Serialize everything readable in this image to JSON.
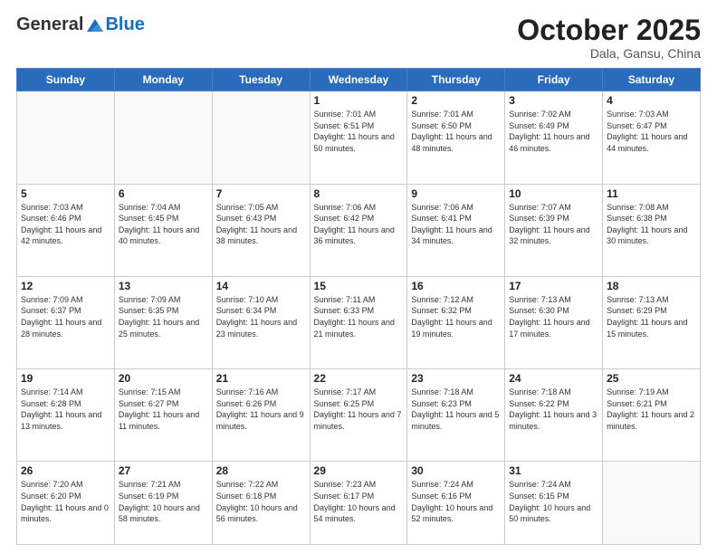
{
  "logo": {
    "general": "General",
    "blue": "Blue"
  },
  "title": "October 2025",
  "location": "Dala, Gansu, China",
  "days_of_week": [
    "Sunday",
    "Monday",
    "Tuesday",
    "Wednesday",
    "Thursday",
    "Friday",
    "Saturday"
  ],
  "weeks": [
    [
      {
        "day": "",
        "info": ""
      },
      {
        "day": "",
        "info": ""
      },
      {
        "day": "",
        "info": ""
      },
      {
        "day": "1",
        "info": "Sunrise: 7:01 AM\nSunset: 6:51 PM\nDaylight: 11 hours\nand 50 minutes."
      },
      {
        "day": "2",
        "info": "Sunrise: 7:01 AM\nSunset: 6:50 PM\nDaylight: 11 hours\nand 48 minutes."
      },
      {
        "day": "3",
        "info": "Sunrise: 7:02 AM\nSunset: 6:49 PM\nDaylight: 11 hours\nand 46 minutes."
      },
      {
        "day": "4",
        "info": "Sunrise: 7:03 AM\nSunset: 6:47 PM\nDaylight: 11 hours\nand 44 minutes."
      }
    ],
    [
      {
        "day": "5",
        "info": "Sunrise: 7:03 AM\nSunset: 6:46 PM\nDaylight: 11 hours\nand 42 minutes."
      },
      {
        "day": "6",
        "info": "Sunrise: 7:04 AM\nSunset: 6:45 PM\nDaylight: 11 hours\nand 40 minutes."
      },
      {
        "day": "7",
        "info": "Sunrise: 7:05 AM\nSunset: 6:43 PM\nDaylight: 11 hours\nand 38 minutes."
      },
      {
        "day": "8",
        "info": "Sunrise: 7:06 AM\nSunset: 6:42 PM\nDaylight: 11 hours\nand 36 minutes."
      },
      {
        "day": "9",
        "info": "Sunrise: 7:06 AM\nSunset: 6:41 PM\nDaylight: 11 hours\nand 34 minutes."
      },
      {
        "day": "10",
        "info": "Sunrise: 7:07 AM\nSunset: 6:39 PM\nDaylight: 11 hours\nand 32 minutes."
      },
      {
        "day": "11",
        "info": "Sunrise: 7:08 AM\nSunset: 6:38 PM\nDaylight: 11 hours\nand 30 minutes."
      }
    ],
    [
      {
        "day": "12",
        "info": "Sunrise: 7:09 AM\nSunset: 6:37 PM\nDaylight: 11 hours\nand 28 minutes."
      },
      {
        "day": "13",
        "info": "Sunrise: 7:09 AM\nSunset: 6:35 PM\nDaylight: 11 hours\nand 25 minutes."
      },
      {
        "day": "14",
        "info": "Sunrise: 7:10 AM\nSunset: 6:34 PM\nDaylight: 11 hours\nand 23 minutes."
      },
      {
        "day": "15",
        "info": "Sunrise: 7:11 AM\nSunset: 6:33 PM\nDaylight: 11 hours\nand 21 minutes."
      },
      {
        "day": "16",
        "info": "Sunrise: 7:12 AM\nSunset: 6:32 PM\nDaylight: 11 hours\nand 19 minutes."
      },
      {
        "day": "17",
        "info": "Sunrise: 7:13 AM\nSunset: 6:30 PM\nDaylight: 11 hours\nand 17 minutes."
      },
      {
        "day": "18",
        "info": "Sunrise: 7:13 AM\nSunset: 6:29 PM\nDaylight: 11 hours\nand 15 minutes."
      }
    ],
    [
      {
        "day": "19",
        "info": "Sunrise: 7:14 AM\nSunset: 6:28 PM\nDaylight: 11 hours\nand 13 minutes."
      },
      {
        "day": "20",
        "info": "Sunrise: 7:15 AM\nSunset: 6:27 PM\nDaylight: 11 hours\nand 11 minutes."
      },
      {
        "day": "21",
        "info": "Sunrise: 7:16 AM\nSunset: 6:26 PM\nDaylight: 11 hours\nand 9 minutes."
      },
      {
        "day": "22",
        "info": "Sunrise: 7:17 AM\nSunset: 6:25 PM\nDaylight: 11 hours\nand 7 minutes."
      },
      {
        "day": "23",
        "info": "Sunrise: 7:18 AM\nSunset: 6:23 PM\nDaylight: 11 hours\nand 5 minutes."
      },
      {
        "day": "24",
        "info": "Sunrise: 7:18 AM\nSunset: 6:22 PM\nDaylight: 11 hours\nand 3 minutes."
      },
      {
        "day": "25",
        "info": "Sunrise: 7:19 AM\nSunset: 6:21 PM\nDaylight: 11 hours\nand 2 minutes."
      }
    ],
    [
      {
        "day": "26",
        "info": "Sunrise: 7:20 AM\nSunset: 6:20 PM\nDaylight: 11 hours\nand 0 minutes."
      },
      {
        "day": "27",
        "info": "Sunrise: 7:21 AM\nSunset: 6:19 PM\nDaylight: 10 hours\nand 58 minutes."
      },
      {
        "day": "28",
        "info": "Sunrise: 7:22 AM\nSunset: 6:18 PM\nDaylight: 10 hours\nand 56 minutes."
      },
      {
        "day": "29",
        "info": "Sunrise: 7:23 AM\nSunset: 6:17 PM\nDaylight: 10 hours\nand 54 minutes."
      },
      {
        "day": "30",
        "info": "Sunrise: 7:24 AM\nSunset: 6:16 PM\nDaylight: 10 hours\nand 52 minutes."
      },
      {
        "day": "31",
        "info": "Sunrise: 7:24 AM\nSunset: 6:15 PM\nDaylight: 10 hours\nand 50 minutes."
      },
      {
        "day": "",
        "info": ""
      }
    ]
  ]
}
